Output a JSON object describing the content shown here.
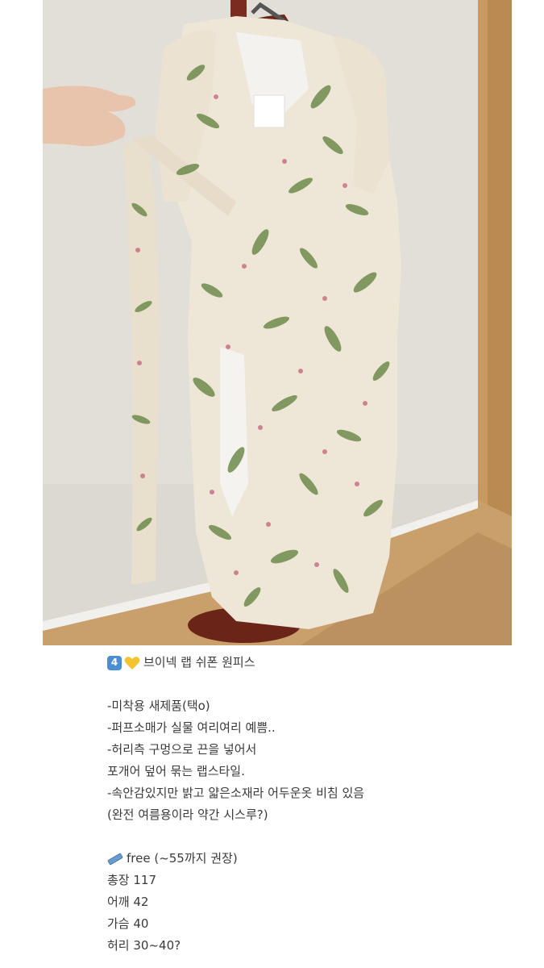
{
  "photo": {
    "subject": "floral chiffon wrap dress on hanger",
    "colors": {
      "wall": "#d9d6d0",
      "floor": "#c8a06b",
      "door": "#c89a62",
      "dress_base": "#efe8da",
      "leaf": "#6d8a4a",
      "flower": "#c77a8a"
    }
  },
  "post": {
    "title_number": "4",
    "title_icon": "yellow-heart-icon",
    "title": "브이넥 랩 쉬폰 원피스",
    "details": [
      "-미착용 새제품(택o)",
      "-퍼프소매가 실물 여리여리 예쁨..",
      "-허리측 구멍으로 끈을 넣어서",
      "포개어 덮어 묶는 랩스타일.",
      "-속안감있지만 밝고 얇은소재라 어두운옷 비침 있음",
      "(완전 여름용이라 약간 시스루?)"
    ],
    "size_icon": "ruler-icon",
    "size_label": "free (~55까지 권장)",
    "measurements": [
      "총장 117",
      "어깨 42",
      "가슴 40",
      "허리 30~40?"
    ]
  }
}
